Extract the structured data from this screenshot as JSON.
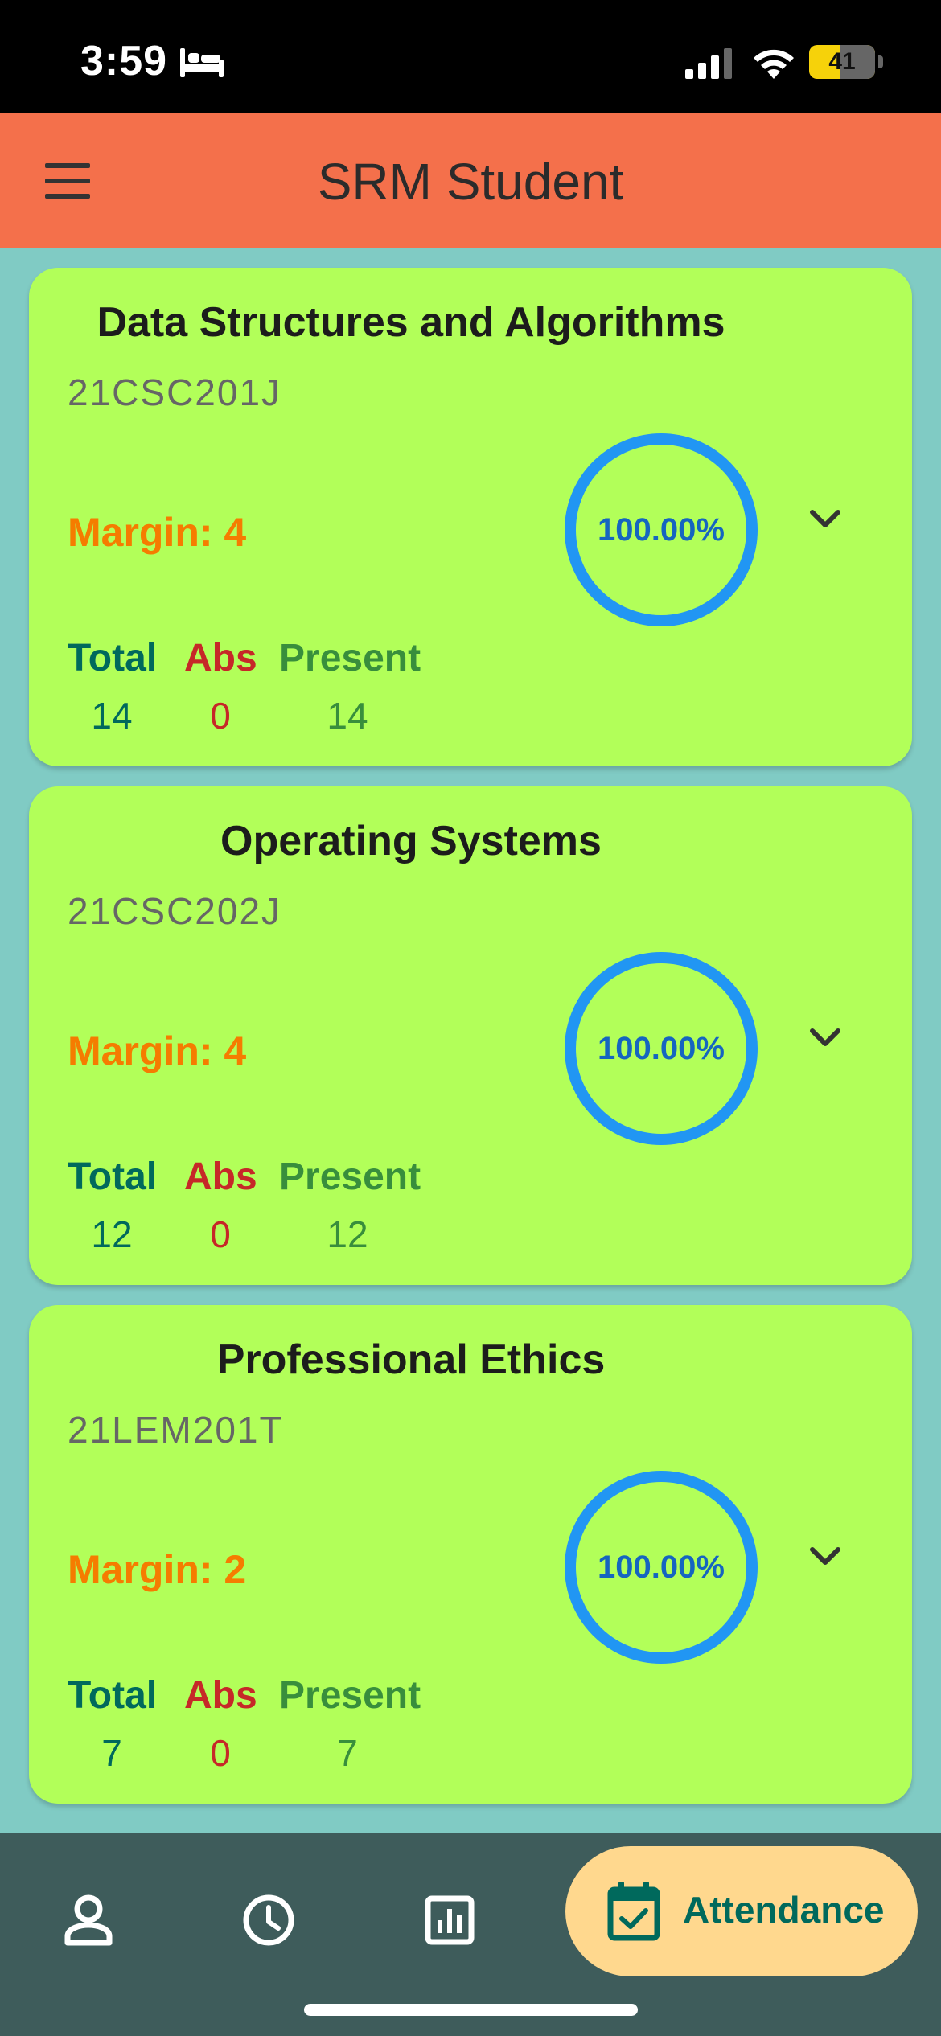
{
  "status_bar": {
    "time": "3:59",
    "battery": "41"
  },
  "app_bar": {
    "title": "SRM Student"
  },
  "labels": {
    "total": "Total",
    "abs": "Abs",
    "present": "Present"
  },
  "courses": [
    {
      "title": "Data Structures and Algorithms",
      "code": "21CSC201J",
      "margin": "Margin: 4",
      "percent": "100.00%",
      "total": "14",
      "abs": "0",
      "present": "14"
    },
    {
      "title": "Operating Systems",
      "code": "21CSC202J",
      "margin": "Margin: 4",
      "percent": "100.00%",
      "total": "12",
      "abs": "0",
      "present": "12"
    },
    {
      "title": "Professional Ethics",
      "code": "21LEM201T",
      "margin": "Margin: 2",
      "percent": "100.00%",
      "total": "7",
      "abs": "0",
      "present": "7"
    }
  ],
  "bottom_nav": {
    "items": [
      {
        "icon": "person-icon"
      },
      {
        "icon": "clock-icon"
      },
      {
        "icon": "bar-chart-icon"
      },
      {
        "icon": "calendar-check-icon",
        "label": "Attendance",
        "active": true
      }
    ]
  },
  "colors": {
    "background": "#80CBC4",
    "app_bar": "#F4704B",
    "card": "#B2FF59",
    "margin_text": "#F57C00",
    "progress_ring": "#2196F3",
    "bottom_nav": "#3E5C5B",
    "active_pill": "#FFD88E"
  }
}
